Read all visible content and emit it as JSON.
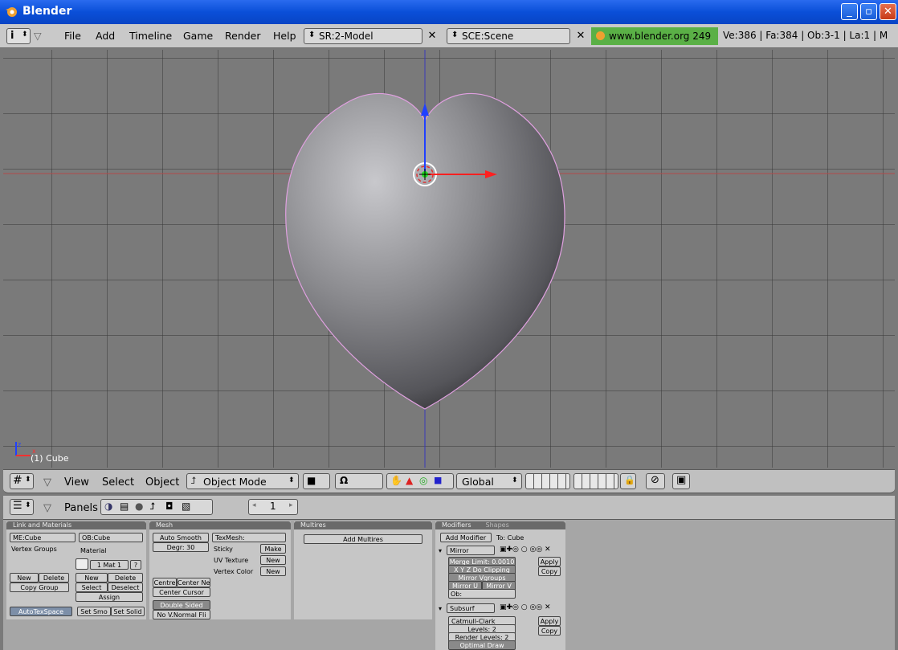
{
  "window": {
    "title": "Blender"
  },
  "topmenu": {
    "items": [
      "File",
      "Add",
      "Timeline",
      "Game",
      "Render",
      "Help"
    ],
    "screen": "SR:2-Model",
    "scene": "SCE:Scene",
    "site": "www.blender.org 249",
    "stats": "Ve:386 | Fa:384 | Ob:3-1 | La:1 | M"
  },
  "viewport": {
    "object_label": "(1) Cube"
  },
  "viewheader": {
    "menus": [
      "View",
      "Select",
      "Object"
    ],
    "mode": "Object Mode",
    "orientation": "Global"
  },
  "buttonsheader": {
    "panels_label": "Panels",
    "frame": "1"
  },
  "panels": {
    "link": {
      "title": "Link and Materials",
      "me": "ME:Cube",
      "ob": "OB:Cube",
      "vertex_groups": "Vertex Groups",
      "material": "Material",
      "mat_index": "1 Mat 1",
      "mat_q": "?",
      "new1": "New",
      "delete1": "Delete",
      "new2": "New",
      "delete2": "Delete",
      "copy_group": "Copy Group",
      "select": "Select",
      "deselect": "Deselect",
      "assign": "Assign",
      "autotex": "AutoTexSpace",
      "setsmo": "Set Smo",
      "setsolid": "Set Solid"
    },
    "mesh": {
      "title": "Mesh",
      "auto_smooth": "Auto Smooth",
      "degr": "Degr: 30",
      "texmesh": "TexMesh:",
      "sticky": "Sticky",
      "make": "Make",
      "uv_texture": "UV Texture",
      "new_uv": "New",
      "vertex_color": "Vertex Color",
      "new_vc": "New",
      "centre": "Centre",
      "center_new": "Center Ne",
      "center_cursor": "Center Cursor",
      "double_sided": "Double Sided",
      "no_vnormal": "No V.Normal Fli"
    },
    "multires": {
      "title": "Multires",
      "add": "Add Multires"
    },
    "modifiers": {
      "tab1": "Modifiers",
      "tab2": "Shapes",
      "add_modifier": "Add Modifier",
      "to": "To: Cube",
      "mirror": "Mirror",
      "merge_limit": "Merge Limit: 0.0010",
      "xyz": "X  Y  Z  Do Clipping",
      "mirror_vgroups": "Mirror Vgroups",
      "mirror_u": "Mirror U",
      "mirror_v": "Mirror V",
      "ob": "Ob:",
      "apply": "Apply",
      "copy": "Copy",
      "subsurf": "Subsurf",
      "catmull": "Catmull-Clark",
      "levels": "Levels: 2",
      "render_levels": "Render Levels: 2",
      "optimal": "Optimal Draw",
      "apply2": "Apply",
      "copy2": "Copy"
    }
  }
}
